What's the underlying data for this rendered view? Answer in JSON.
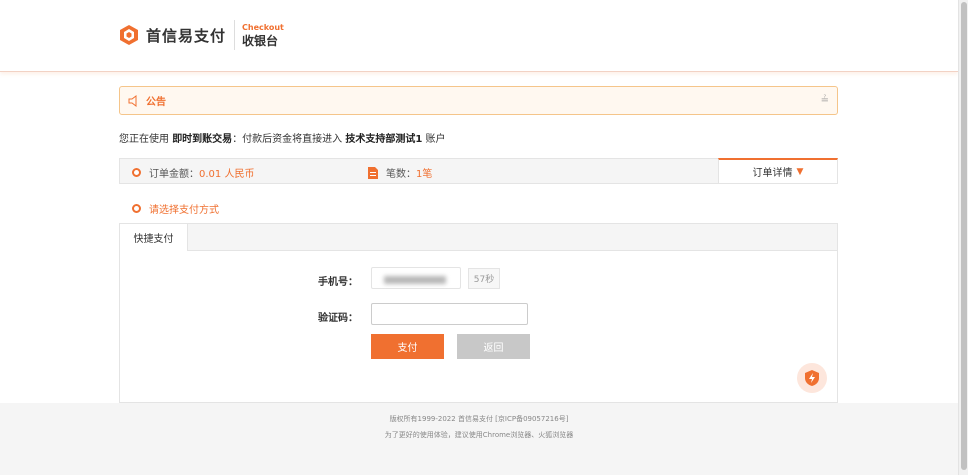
{
  "header": {
    "brand_name": "首信易支付",
    "checkout_en": "Checkout",
    "checkout_cn": "收银台"
  },
  "notice": {
    "title": "公告",
    "close_glyph": "≟"
  },
  "info": {
    "prefix": "您正在使用",
    "trade_type": "即时到账交易",
    "middle": "：付款后资金将直接进入",
    "account_name": "技术支持部测试1",
    "suffix": "账户"
  },
  "order": {
    "amount_label": "订单金额：",
    "amount_value": "0.01 人民币",
    "count_label": "笔数：",
    "count_value": "1笔",
    "detail_label": "订单详情",
    "detail_arrow": "▼"
  },
  "payment": {
    "choose_label": "请选择支付方式",
    "tab_label": "快捷支付",
    "phone_label": "手机号：",
    "countdown": "57秒",
    "code_label": "验证码：",
    "code_placeholder": "",
    "pay_button": "支付",
    "back_button": "返回"
  },
  "footer": {
    "copyright": "版权所有1999-2022 首信易支付 [京ICP备09057216号]",
    "browser_tip": "为了更好的使用体验，建议使用Chrome浏览器、火狐浏览器"
  },
  "colors": {
    "accent": "#f07030",
    "notice_bg": "#fff8f0",
    "notice_border": "#f5c58a",
    "back_button": "#c8c8c8"
  },
  "icons": {
    "logo": "brand-logo-icon",
    "notice": "megaphone-icon",
    "count": "document-icon",
    "float": "lightning-shield-icon"
  }
}
